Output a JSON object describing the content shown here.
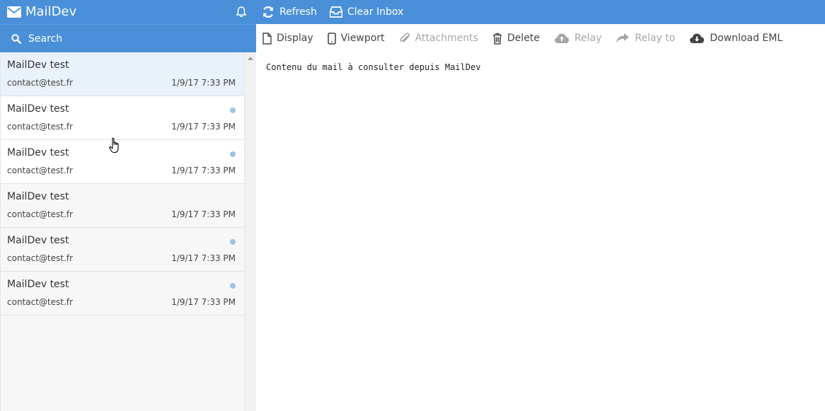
{
  "header": {
    "title": "MailDev",
    "actions": [
      {
        "label": "Refresh",
        "icon": "refresh-icon"
      },
      {
        "label": "Clear Inbox",
        "icon": "inbox-icon"
      }
    ]
  },
  "search": {
    "placeholder": "Search"
  },
  "mails": [
    {
      "subject": "MailDev test",
      "from": "contact@test.fr",
      "date": "1/9/17 7:33 PM",
      "unread": false,
      "selected": true
    },
    {
      "subject": "MailDev test",
      "from": "contact@test.fr",
      "date": "1/9/17 7:33 PM",
      "unread": true,
      "selected": false
    },
    {
      "subject": "MailDev test",
      "from": "contact@test.fr",
      "date": "1/9/17 7:33 PM",
      "unread": true,
      "selected": false
    },
    {
      "subject": "MailDev test",
      "from": "contact@test.fr",
      "date": "1/9/17 7:33 PM",
      "unread": false,
      "selected": false
    },
    {
      "subject": "MailDev test",
      "from": "contact@test.fr",
      "date": "1/9/17 7:33 PM",
      "unread": true,
      "selected": false
    },
    {
      "subject": "MailDev test",
      "from": "contact@test.fr",
      "date": "1/9/17 7:33 PM",
      "unread": true,
      "selected": false
    }
  ],
  "toolbar": {
    "display": "Display",
    "viewport": "Viewport",
    "attachments": "Attachments",
    "delete": "Delete",
    "relay": "Relay",
    "relay_to": "Relay to",
    "download": "Download EML"
  },
  "message": {
    "body": "Contenu du mail à consulter depuis MailDev"
  },
  "colors": {
    "accent": "#4a90d9",
    "unread_dot": "#9cc3ea",
    "selected_row": "#e9f1fa"
  }
}
